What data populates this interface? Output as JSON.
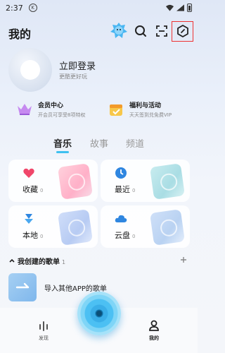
{
  "status_bar": {
    "time": "2:37",
    "notification_glyph": "K"
  },
  "header": {
    "title": "我的"
  },
  "profile": {
    "login": "立即登录",
    "subtitle": "更酷更好玩"
  },
  "promos": [
    {
      "title": "会员中心",
      "subtitle": "开会员可享受8项特权"
    },
    {
      "title": "福利与活动",
      "subtitle": "天天签到兑免费VIP"
    }
  ],
  "tabs": [
    {
      "label": "音乐",
      "active": true
    },
    {
      "label": "故事",
      "active": false
    },
    {
      "label": "频道",
      "active": false
    }
  ],
  "cards": [
    {
      "label": "收藏",
      "count": "0",
      "icon": "heart-icon"
    },
    {
      "label": "最近",
      "count": "0",
      "icon": "clock-icon"
    },
    {
      "label": "本地",
      "count": "0",
      "icon": "download-icon"
    },
    {
      "label": "云盘",
      "count": "0",
      "icon": "cloud-icon"
    }
  ],
  "playlists": {
    "title": "我创建的歌单",
    "count": "1",
    "import_label": "导入其他APP的歌单"
  },
  "bottom_nav": {
    "discover": "发现",
    "mine": "我的"
  },
  "colors": {
    "accent": "#3ec0f0",
    "highlight": "#ee3333"
  }
}
